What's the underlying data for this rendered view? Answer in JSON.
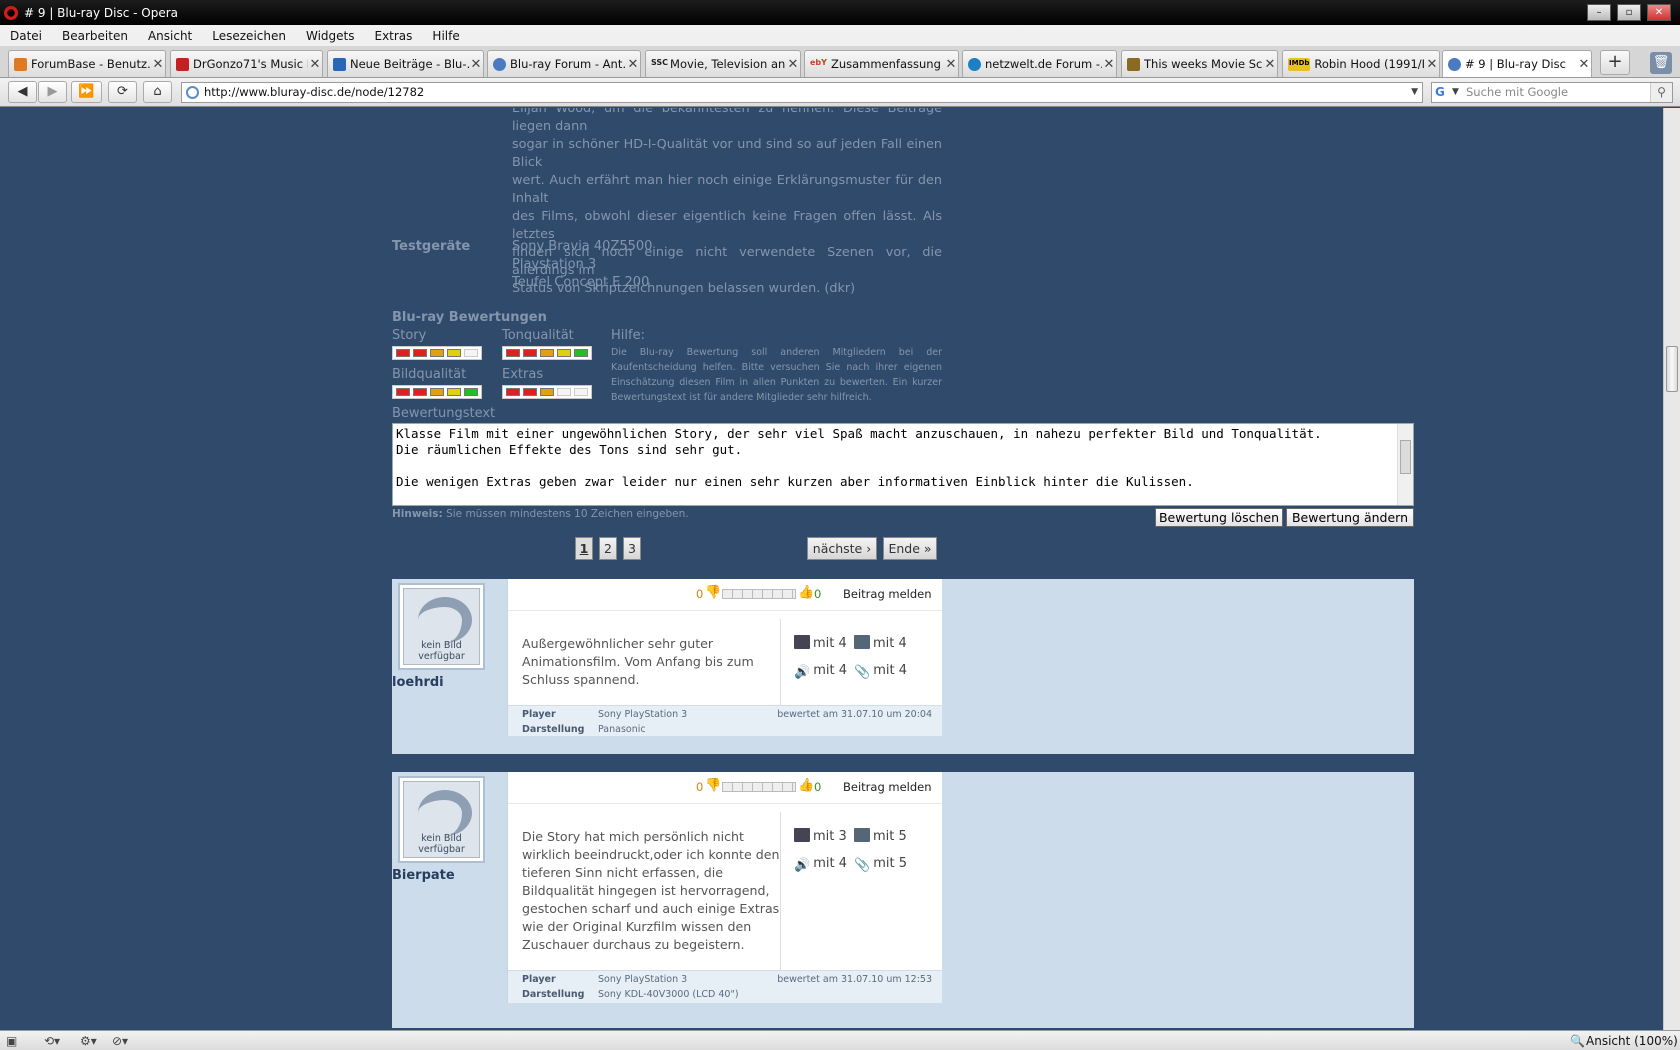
{
  "window": {
    "title": "# 9 | Blu-ray Disc - Opera",
    "controls": [
      "–",
      "▫",
      "✕"
    ]
  },
  "menu": [
    "Datei",
    "Bearbeiten",
    "Ansicht",
    "Lesezeichen",
    "Widgets",
    "Extras",
    "Hilfe"
  ],
  "tabs": [
    {
      "label": "ForumBase - Benutz…",
      "icon_color": "#e07a20"
    },
    {
      "label": "DrGonzo71's Music P…",
      "icon_color": "#c22222"
    },
    {
      "label": "Neue Beiträge - Blu-…",
      "icon_color": "#2a66b8"
    },
    {
      "label": "Blu-ray Forum - Ant…",
      "icon_color": "#4a7bbf"
    },
    {
      "label": "Movie, Television an…",
      "icon_color": "#222222",
      "icon_text": "SSC"
    },
    {
      "label": "Zusammenfassung",
      "icon_color": "#d43a2a",
      "icon_text": "ebY"
    },
    {
      "label": "netzwelt.de Forum -…",
      "icon_color": "#1f7fc4"
    },
    {
      "label": "This weeks Movie Sc…",
      "icon_color": "#8a6a20"
    },
    {
      "label": "Robin Hood (1991/I)…",
      "icon_color": "#e8c020",
      "icon_text": "IMDb"
    },
    {
      "label": "# 9 | Blu-ray Disc",
      "icon_color": "#4a7bbf",
      "active": true
    }
  ],
  "nav": {
    "url": "http://www.bluray-disc.de/node/12782",
    "search_placeholder": "Suche mit Google"
  },
  "article": {
    "text_lines": [
      "Elijah Wood, um die bekanntesten zu nennen. Diese Beiträge liegen dann",
      "sogar in schöner HD-I-Qualität vor und sind so auf jeden Fall einen Blick",
      "wert. Auch erfährt man hier noch einige Erklärungsmuster für den Inhalt",
      "des Films, obwohl dieser eigentlich keine Fragen offen lässt. Als letztes",
      "finden sich noch einige nicht verwendete Szenen vor, die allerdings im",
      "Status von Skriptzeichnungen belassen wurden. (dkr)"
    ],
    "testgeraete_label": "Testgeräte",
    "testgeraete": [
      "Sony Bravia 40Z5500",
      "Playstation 3",
      "Teufel Concept E 200"
    ]
  },
  "ratings": {
    "heading": "Blu-ray Bewertungen",
    "categories": [
      {
        "label": "Story",
        "level": 4
      },
      {
        "label": "Tonqualität",
        "level": 5
      },
      {
        "label": "Bildqualität",
        "level": 5
      },
      {
        "label": "Extras",
        "level": 3
      }
    ],
    "help_label": "Hilfe:",
    "help_text": "Die Blu-ray Bewertung soll anderen Mitgliedern bei der Kaufentscheidung helfen. Bitte versuchen Sie nach ihrer eigenen Einschätzung diesen Film in allen Punkten zu bewerten. Ein kurzer Bewertungstext ist für andere Mitglieder sehr hilfreich.",
    "text_label": "Bewertungstext",
    "text_value": "Klasse Film mit einer ungewöhnlichen Story, der sehr viel Spaß macht anzuschauen, in nahezu perfekter Bild und Tonqualität.\nDie räumlichen Effekte des Tons sind sehr gut.\n\nDie wenigen Extras geben zwar leider nur einen sehr kurzen aber informativen Einblick hinter die Kulissen.",
    "hint_label": "Hinweis:",
    "hint_text": "Sie müssen mindestens 10 Zeichen eingeben.",
    "delete_button": "Bewertung löschen",
    "change_button": "Bewertung ändern",
    "colors": [
      "#e02020",
      "#e02020",
      "#e0a010",
      "#e0d010",
      "#20c020"
    ]
  },
  "pager": {
    "pages": [
      "1",
      "2",
      "3"
    ],
    "next": "nächste ›",
    "last": "Ende »"
  },
  "reviews": [
    {
      "user": "loehrdi",
      "avatar_caption": "kein Bild verfügbar",
      "votes_minus": "0",
      "votes_plus": "0",
      "report": "Beitrag melden",
      "text": [
        "Außergewöhnlicher sehr guter",
        "Animationsfilm. Vom Anfang bis zum",
        "Schluss spannend."
      ],
      "ratings": [
        "mit 4",
        "mit 4",
        "mit 4",
        "mit 4"
      ],
      "player_label": "Player",
      "player": "Sony PlayStation 3",
      "display_label": "Darstellung",
      "display": "Panasonic",
      "date": "bewertet am 31.07.10 um 20:04"
    },
    {
      "user": "Bierpate",
      "avatar_caption": "kein Bild verfügbar",
      "votes_minus": "0",
      "votes_plus": "0",
      "report": "Beitrag melden",
      "text": [
        "Die Story hat mich persönlich nicht",
        "wirklich beeindruckt,oder ich konnte den",
        "tieferen Sinn nicht erfassen, die",
        "Bildqualität hingegen ist hervorragend,",
        "gestochen scharf und auch einige Extras",
        "wie der Original Kurzfilm wissen den",
        "Zuschauer durchaus zu begeistern."
      ],
      "ratings": [
        "mit 3",
        "mit 5",
        "mit 4",
        "mit 5"
      ],
      "player_label": "Player",
      "player": "Sony PlayStation 3",
      "display_label": "Darstellung",
      "display": "Sony KDL-40V3000 (LCD 40\")",
      "date": "bewertet am 31.07.10 um 12:53"
    }
  ],
  "status": {
    "zoom": "Ansicht (100%)"
  }
}
